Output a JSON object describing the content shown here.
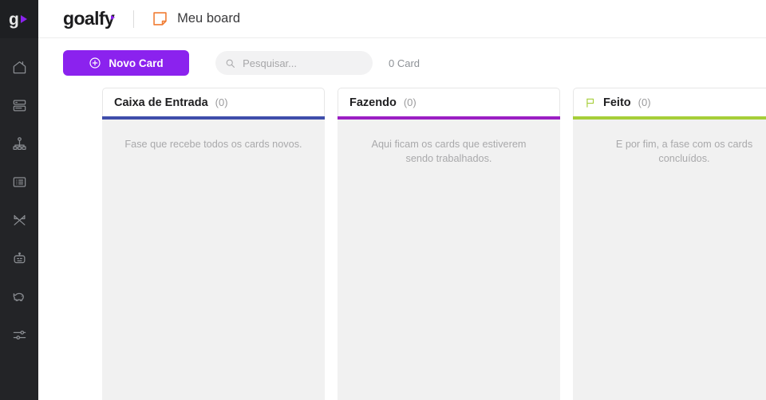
{
  "sidebar": {
    "logo": {
      "letter": "g",
      "name": "goalfy-logo",
      "accent_color": "#8b22ee"
    },
    "items": [
      {
        "icon": "home-icon",
        "name": "sidebar-item-home"
      },
      {
        "icon": "database-icon",
        "name": "sidebar-item-database"
      },
      {
        "icon": "org-chart-icon",
        "name": "sidebar-item-org-chart"
      },
      {
        "icon": "list-icon",
        "name": "sidebar-item-list"
      },
      {
        "icon": "flow-icon",
        "name": "sidebar-item-flow"
      },
      {
        "icon": "robot-icon",
        "name": "sidebar-item-robot"
      },
      {
        "icon": "piggy-bank-icon",
        "name": "sidebar-item-piggy-bank"
      },
      {
        "icon": "sliders-icon",
        "name": "sidebar-item-settings"
      }
    ]
  },
  "header": {
    "brand": "goalfy",
    "board_icon": "sticky-note-icon",
    "board_icon_color": "#f07c33",
    "board_title": "Meu board"
  },
  "toolbar": {
    "new_card_label": "Novo Card",
    "new_card_icon": "plus-circle-icon",
    "new_card_color": "#8b22ee",
    "search_icon": "search-icon",
    "search_value": "",
    "search_placeholder": "Pesquisar...",
    "card_count": "0 Card"
  },
  "board": {
    "columns": [
      {
        "title": "Caixa de Entrada",
        "count": "(0)",
        "accent": "#3f4eab",
        "description": "Fase que recebe todos os cards novos.",
        "has_flag": false
      },
      {
        "title": "Fazendo",
        "count": "(0)",
        "accent": "#9b1fc4",
        "description": "Aqui ficam os cards que estiverem sendo trabalhados.",
        "has_flag": false
      },
      {
        "title": "Feito",
        "count": "(0)",
        "accent": "#a6ce39",
        "description": "E por fim, a fase com os cards concluídos.",
        "has_flag": true,
        "flag_icon": "flag-icon"
      }
    ]
  }
}
